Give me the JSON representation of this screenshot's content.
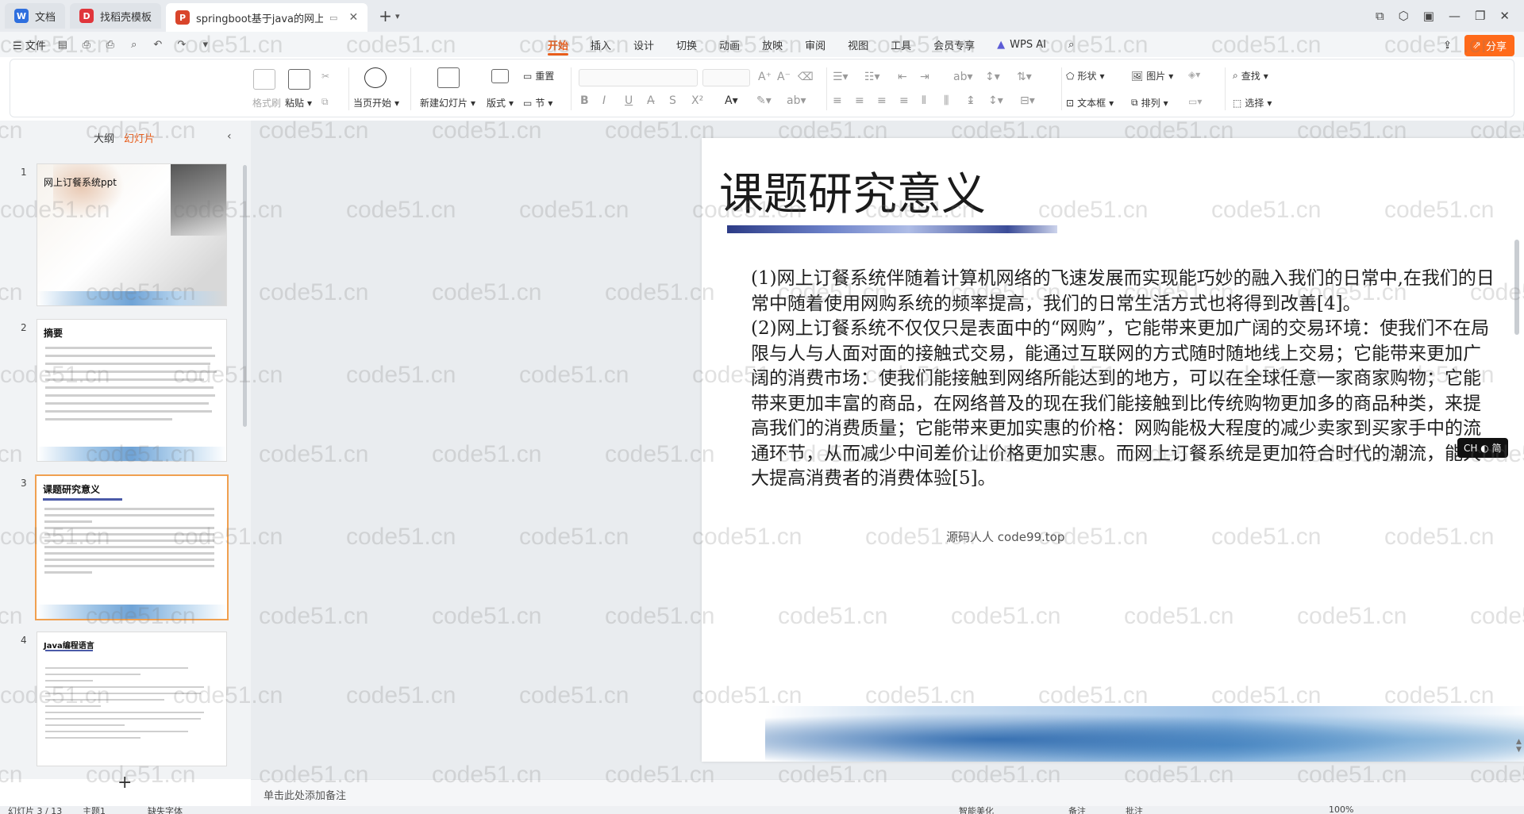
{
  "tabs": [
    {
      "label": "文档",
      "icon": "document-icon",
      "color": "#2f6fde"
    },
    {
      "label": "找稻壳模板",
      "icon": "docer-icon",
      "color": "#e0353b"
    },
    {
      "label": "springboot基于java的网上订",
      "icon": "presentation-icon",
      "color": "#d9452b"
    }
  ],
  "menu": {
    "file": "文件",
    "tabs": [
      "开始",
      "插入",
      "设计",
      "切换",
      "动画",
      "放映",
      "审阅",
      "视图",
      "工具",
      "会员专享"
    ],
    "active_tab": "开始",
    "wps_ai": "WPS AI",
    "share": "分享"
  },
  "ribbon": {
    "format_painter": "格式刷",
    "paste": "粘贴",
    "start_current": "当页开始",
    "new_slide": "新建幻灯片",
    "layout": "版式",
    "reset": "重置",
    "section": "节",
    "shape": "形状",
    "picture": "图片",
    "textbox": "文本框",
    "arrange": "排列",
    "find": "查找",
    "select": "选择"
  },
  "panel": {
    "outline_tab": "大纲",
    "slides_tab": "幻灯片",
    "thumbs": [
      {
        "num": "1",
        "title": "网上订餐系统ppt"
      },
      {
        "num": "2",
        "title": "摘要"
      },
      {
        "num": "3",
        "title": "课题研究意义"
      },
      {
        "num": "4",
        "title": "Java编程语言"
      }
    ]
  },
  "slide": {
    "title": "课题研究意义",
    "paragraphs": [
      "(1)网上订餐系统伴随着计算机网络的飞速发展而实现能巧妙的融入我们的日常中,在我们的日常中随着使用网购系统的频率提高，我们的日常生活方式也将得到改善[4]。",
      "(2)网上订餐系统不仅仅只是表面中的“网购”，它能带来更加广阔的交易环境：使我们不在局限与人与人面对面的接触式交易，能通过互联网的方式随时随地线上交易；它能带来更加广阔的消费市场：使我们能接触到网络所能达到的地方，可以在全球任意一家商家购物；它能带来更加丰富的商品，在网络普及的现在我们能接触到比传统购物更加多的商品种类，来提高我们的消费质量；它能带来更加实惠的价格：网购能极大程度的减少卖家到买家手中的流通环节，从而减少中间差价让价格更加实惠。而网上订餐系统是更加符合时代的潮流，能大大提高消费者的消费体验[5]。"
    ],
    "overlay": "源码人人 code99.top"
  },
  "ime": "CH ◐ 简",
  "notes": {
    "placeholder": "单击此处添加备注"
  },
  "status": {
    "slide_info": "幻灯片 3 / 13",
    "theme": "主题1",
    "font_missing": "缺失字体",
    "smart_beautify": "智能美化",
    "notes": "备注",
    "comments": "批注",
    "zoom": "100%"
  },
  "watermark": "code51.cn",
  "colors": {
    "accent": "#e85d1b",
    "share": "#ff6a1a"
  }
}
